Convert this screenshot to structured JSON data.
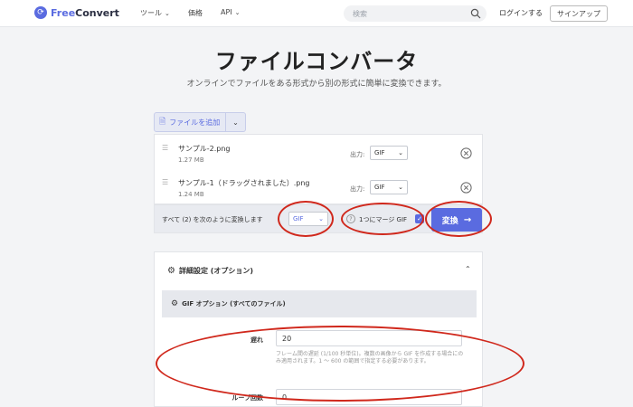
{
  "header": {
    "logo_mark": "⟳",
    "logo_free": "Free",
    "logo_convert": "Convert",
    "nav_tools": "ツール",
    "nav_price": "価格",
    "nav_api": "API",
    "search_placeholder": "検索",
    "login": "ログインする",
    "signup": "サインアップ"
  },
  "hero": {
    "title": "ファイルコンバータ",
    "subtitle": "オンラインでファイルをある形式から別の形式に簡単に変換できます。"
  },
  "add_file": {
    "label": "ファイルを追加"
  },
  "files": [
    {
      "name": "サンプル-2.png",
      "size": "1.27 MB",
      "output_label": "出力:",
      "format": "GIF"
    },
    {
      "name": "サンプル-1（ドラッグされました）.png",
      "size": "1.24 MB",
      "output_label": "出力:",
      "format": "GIF"
    }
  ],
  "convert_bar": {
    "convert_all_text": "すべて (2) を次のように変換します",
    "all_format": "GIF",
    "merge_label": "1つにマージ GIF",
    "merge_checked": true,
    "convert_button": "変換"
  },
  "advanced": {
    "title": "詳細設定 (オプション)",
    "gif_options_title": "GIF オプション (すべてのファイル)",
    "delay_label": "遅れ",
    "delay_value": "20",
    "delay_help": "フレーム間の遅延 (1/100 秒単位)。複数の画像から GIF を作成する場合にのみ適用されます。1 ～ 600 の範囲で指定する必要があります。",
    "loop_label": "ループ回数",
    "loop_value": "0"
  },
  "colors": {
    "accent": "#5a6be0",
    "annotation": "#d0281c"
  }
}
